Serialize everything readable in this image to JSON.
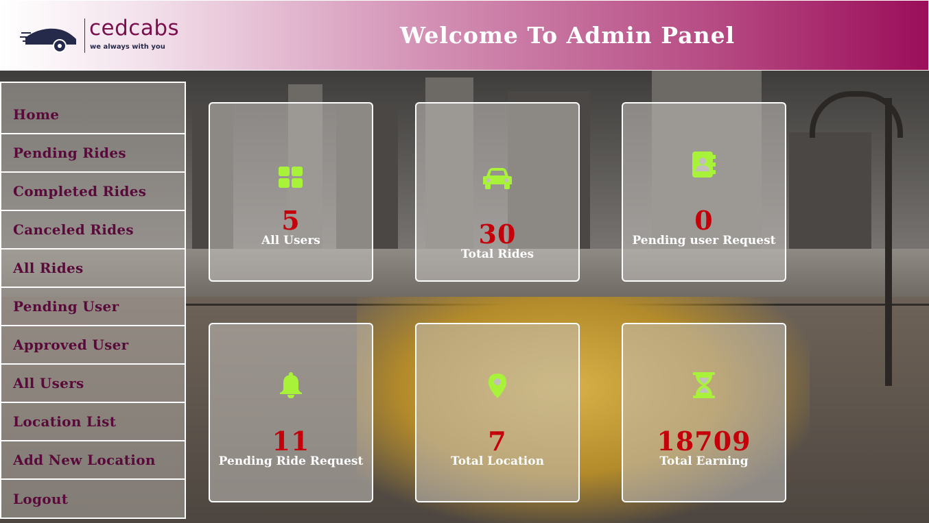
{
  "header": {
    "title": "Welcome To Admin Panel",
    "logo_name": "cedcabs",
    "logo_tagline": "we always with you",
    "gradient_colors": [
      "#ffffff",
      "#d493b6",
      "#9b0e5a"
    ]
  },
  "sidebar": {
    "items": [
      {
        "label": "Home"
      },
      {
        "label": "Pending Rides"
      },
      {
        "label": "Completed Rides"
      },
      {
        "label": "Canceled Rides"
      },
      {
        "label": "All Rides"
      },
      {
        "label": "Pending User"
      },
      {
        "label": "Approved User"
      },
      {
        "label": "All Users"
      },
      {
        "label": "Location List"
      },
      {
        "label": "Add New Location"
      },
      {
        "label": "Logout"
      }
    ],
    "text_color": "#5a0a3a"
  },
  "cards": [
    {
      "icon": "grid-icon",
      "value": "5",
      "label": "All Users"
    },
    {
      "icon": "car-icon",
      "value": "30",
      "label": "Total Rides"
    },
    {
      "icon": "contact-book-icon",
      "value": "0",
      "label": "Pending user Request"
    },
    {
      "icon": "bell-icon",
      "value": "11",
      "label": "Pending Ride Request"
    },
    {
      "icon": "map-marker-icon",
      "value": "7",
      "label": "Total Location"
    },
    {
      "icon": "hourglass-icon",
      "value": "18709",
      "label": "Total Earning"
    }
  ],
  "colors": {
    "icon": "#a8f23a",
    "value": "#c4000a"
  }
}
